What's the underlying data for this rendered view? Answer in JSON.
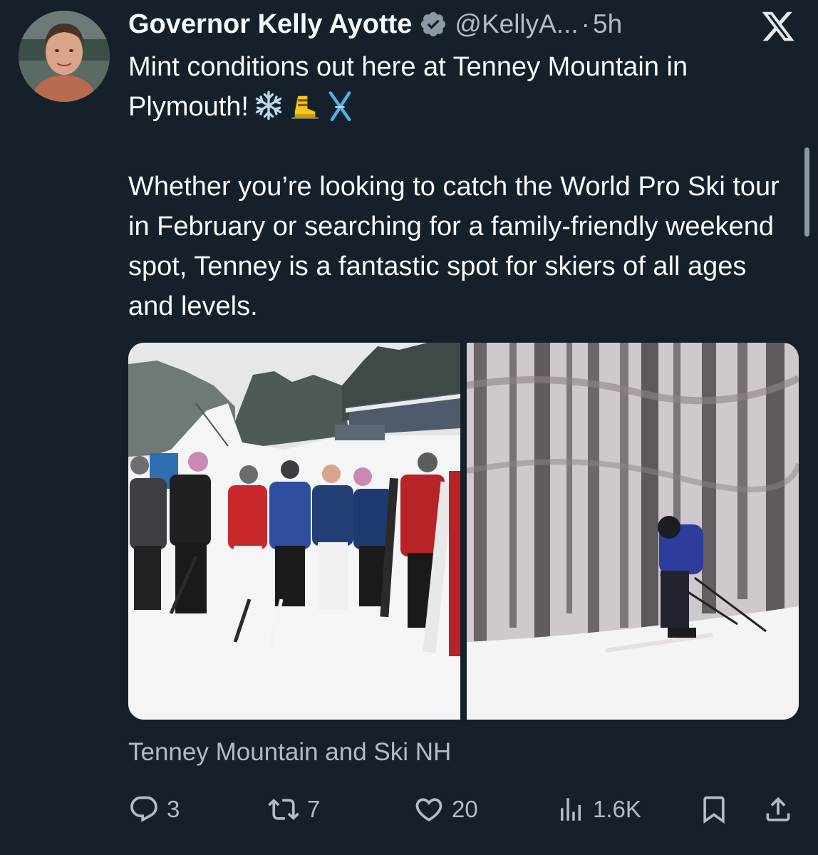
{
  "tweet": {
    "display_name": "Governor Kelly Ayotte",
    "handle": "@KellyA...",
    "separator": "·",
    "time": "5h",
    "text_line_1": "Mint conditions out here at Tenney Mountain in Plymouth!",
    "text_paragraph_2": "Whether you’re looking to catch the World Pro Ski tour in February or searching for a family-friendly weekend spot, Tenney is a fantastic spot for skiers of all ages and levels.",
    "emojis": [
      "snowflake-emoji",
      "ski-boot-emoji",
      "skis-emoji"
    ],
    "media_attribution": "Tenney Mountain and Ski NH"
  },
  "actions": {
    "replies": "3",
    "reposts": "7",
    "likes": "20",
    "views": "1.6K"
  },
  "icons": {
    "platform_logo": "x-logo-icon",
    "verified": "verified-badge-icon",
    "reply": "reply-icon",
    "repost": "repost-icon",
    "like": "heart-icon",
    "views": "views-chart-icon",
    "bookmark": "bookmark-icon",
    "share": "share-icon"
  },
  "colors": {
    "background": "#15202b",
    "primary_text": "#f7f9f9",
    "secondary_text": "#b3bcc4"
  }
}
